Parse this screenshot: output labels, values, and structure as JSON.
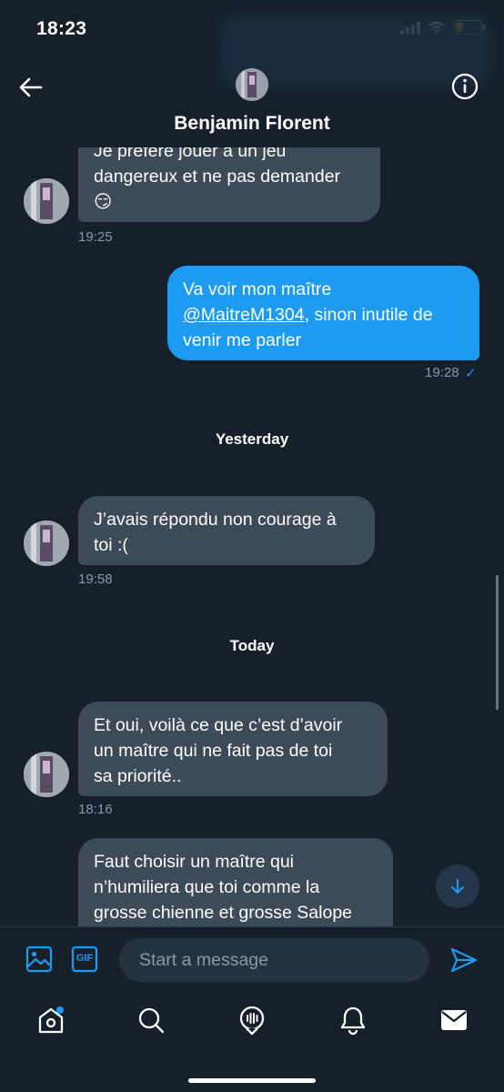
{
  "status_bar": {
    "time": "18:23",
    "battery_level": 0.3
  },
  "header": {
    "contact_name": "Benjamin Florent",
    "back_icon": "arrow-left-icon",
    "info_icon": "info-icon"
  },
  "messages": [
    {
      "direction": "in",
      "lines": [
        "Je préfère jouer à un jeu",
        "dangereux et ne pas demander",
        "😏"
      ],
      "time": "19:25"
    },
    {
      "direction": "out",
      "line1": "Va voir mon maître",
      "mention": "@MaitreM1304",
      "line2_rest": ", sinon inutile de",
      "line3": "venir me parler",
      "time": "19:28",
      "status": "✓"
    },
    {
      "direction": "in",
      "lines": [
        "J’avais répondu non courage à",
        "toi :("
      ],
      "time": "19:58"
    },
    {
      "direction": "in",
      "lines": [
        "Et oui, voilà ce que c’est d’avoir",
        "un maître qui ne fait pas de toi",
        "sa priorité.."
      ],
      "time": "18:16"
    },
    {
      "direction": "in",
      "lines": [
        "Faut choisir un maître qui",
        "n’humiliera que toi comme la",
        "grosse chienne et grosse Salope",
        "😏"
      ]
    }
  ],
  "day_separators": [
    "Yesterday",
    "Today"
  ],
  "composer": {
    "placeholder": "Start a message",
    "gif_label": "GIF"
  },
  "colors": {
    "background": "#15202b",
    "incoming_bubble": "#3d4a58",
    "outgoing_bubble": "#1d9bf0",
    "accent": "#1d9bf0",
    "muted_text": "#8b98a5"
  },
  "tabbar": {
    "items": [
      "home-icon",
      "search-icon",
      "spaces-icon",
      "notifications-icon",
      "messages-icon"
    ]
  }
}
